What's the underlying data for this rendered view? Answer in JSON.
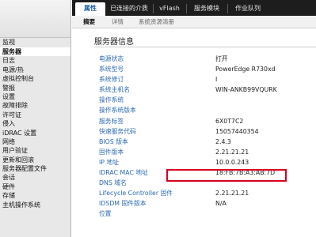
{
  "sidebar": {
    "items": [
      {
        "label": "监视"
      },
      {
        "label": "服务器",
        "selected": true
      },
      {
        "label": "日志"
      },
      {
        "label": "电源/热"
      },
      {
        "label": "虚拟控制台"
      },
      {
        "label": "警报"
      },
      {
        "label": "设置"
      },
      {
        "label": "故障排除"
      },
      {
        "label": "许可证"
      },
      {
        "label": "侵入"
      },
      {
        "label": "iDRAC 设置"
      },
      {
        "label": "网络"
      },
      {
        "label": "用户验证"
      },
      {
        "label": "更新和回滚"
      },
      {
        "label": "服务器配置文件"
      },
      {
        "label": "会话"
      },
      {
        "label": "硬件"
      },
      {
        "label": "存储"
      },
      {
        "label": "主机操作系统"
      }
    ]
  },
  "topbar": {
    "tabs": [
      {
        "label": "属性",
        "active": true
      },
      {
        "label": "已连接的介质"
      },
      {
        "label": "vFlash"
      },
      {
        "label": "服务模块"
      },
      {
        "label": "作业队列"
      }
    ]
  },
  "subtabs": [
    {
      "label": "摘要",
      "active": true
    },
    {
      "label": "详情"
    },
    {
      "label": "系统资源清册"
    }
  ],
  "main": {
    "title": "服务器信息",
    "rows": [
      {
        "label": "电源状态",
        "value": "打开"
      },
      {
        "label": "系统型号",
        "value": "PowerEdge R730xd"
      },
      {
        "label": "系统修订",
        "value": "I"
      },
      {
        "label": "系统主机名",
        "value": "WIN-ANKB99VQURK"
      },
      {
        "label": "操作系统",
        "value": ""
      },
      {
        "label": "操作系统版本",
        "value": ""
      },
      {
        "label": "服务标签",
        "value": "6X0T7C2"
      },
      {
        "label": "快速服务代码",
        "value": "15057440354"
      },
      {
        "label": "BIOS 版本",
        "value": "2.4.3"
      },
      {
        "label": "固件版本",
        "value": "2.21.21.21"
      },
      {
        "label": "IP 地址",
        "value": "10.0.0.243"
      },
      {
        "label": "IDRAC MAC 地址",
        "value": "18:FB:7B:A3:AB:7D"
      },
      {
        "label": "DNS 域名",
        "value": ""
      },
      {
        "label": "Lifecycle Controller 固件",
        "value": "2.21.21.21"
      },
      {
        "label": "IDSDM 固件版本",
        "value": "N/A"
      },
      {
        "label": "位置",
        "value": ""
      }
    ],
    "highlight_color": "#d8001f"
  },
  "colors": {
    "label_blue": "#2b6ab2",
    "topbar_bg": "#1d1d1d",
    "sidebar_bg": "#e8e8e8"
  }
}
